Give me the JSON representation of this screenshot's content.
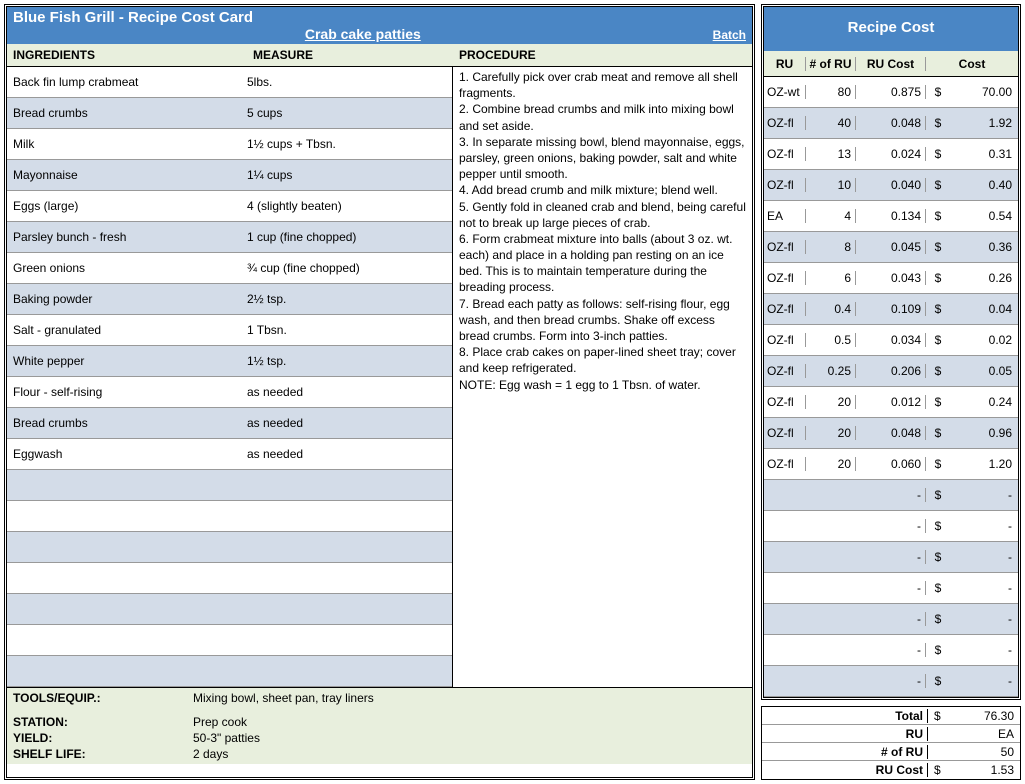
{
  "title": "Blue Fish Grill - Recipe Cost Card",
  "recipe_name": "Crab cake patties",
  "batch_label": "Batch",
  "recipe_cost_title": "Recipe Cost",
  "headers": {
    "ingredients": "INGREDIENTS",
    "measure": "MEASURE",
    "procedure": "PROCEDURE",
    "ru": "RU",
    "num_ru": "# of RU",
    "ru_cost": "RU Cost",
    "cost": "Cost"
  },
  "procedure_text": "1. Carefully pick over crab meat and remove all shell fragments.\n2. Combine bread crumbs and milk into mixing bowl and set aside.\n3. In separate missing bowl, blend mayonnaise, eggs, parsley, green onions, baking powder, salt and white pepper until smooth.\n4. Add bread crumb and milk mixture; blend well.\n5. Gently fold in cleaned crab and blend, being careful not to break up large pieces of crab.\n6. Form crabmeat mixture into balls (about 3 oz. wt. each) and place in a holding pan resting on an ice bed. This is to maintain temperature during the breading process.\n7. Bread each patty as follows: self-rising flour, egg wash, and then bread crumbs. Shake off excess bread crumbs. Form into 3-inch patties.\n8. Place crab cakes on paper-lined sheet tray; cover and keep refrigerated.\nNOTE: Egg wash = 1 egg to 1 Tbsn. of water.",
  "ingredients": [
    {
      "name": "Back fin lump crabmeat",
      "measure": "5lbs.",
      "ru": "OZ-wt",
      "num_ru": "80",
      "ru_cost": "0.875",
      "cost": "70.00"
    },
    {
      "name": "Bread crumbs",
      "measure": "5 cups",
      "ru": "OZ-fl",
      "num_ru": "40",
      "ru_cost": "0.048",
      "cost": "1.92"
    },
    {
      "name": "Milk",
      "measure": "1½ cups + Tbsn.",
      "ru": "OZ-fl",
      "num_ru": "13",
      "ru_cost": "0.024",
      "cost": "0.31"
    },
    {
      "name": "Mayonnaise",
      "measure": "1¼ cups",
      "ru": "OZ-fl",
      "num_ru": "10",
      "ru_cost": "0.040",
      "cost": "0.40"
    },
    {
      "name": "Eggs (large)",
      "measure": "4 (slightly beaten)",
      "ru": "EA",
      "num_ru": "4",
      "ru_cost": "0.134",
      "cost": "0.54"
    },
    {
      "name": "Parsley bunch - fresh",
      "measure": "1 cup (fine chopped)",
      "ru": "OZ-fl",
      "num_ru": "8",
      "ru_cost": "0.045",
      "cost": "0.36"
    },
    {
      "name": "Green onions",
      "measure": "¾ cup (fine chopped)",
      "ru": "OZ-fl",
      "num_ru": "6",
      "ru_cost": "0.043",
      "cost": "0.26"
    },
    {
      "name": "Baking powder",
      "measure": "2½ tsp.",
      "ru": "OZ-fl",
      "num_ru": "0.4",
      "ru_cost": "0.109",
      "cost": "0.04"
    },
    {
      "name": "Salt - granulated",
      "measure": "1 Tbsn.",
      "ru": "OZ-fl",
      "num_ru": "0.5",
      "ru_cost": "0.034",
      "cost": "0.02"
    },
    {
      "name": "White pepper",
      "measure": "1½ tsp.",
      "ru": "OZ-fl",
      "num_ru": "0.25",
      "ru_cost": "0.206",
      "cost": "0.05"
    },
    {
      "name": "Flour - self-rising",
      "measure": "as needed",
      "ru": "OZ-fl",
      "num_ru": "20",
      "ru_cost": "0.012",
      "cost": "0.24"
    },
    {
      "name": "Bread crumbs",
      "measure": "as needed",
      "ru": "OZ-fl",
      "num_ru": "20",
      "ru_cost": "0.048",
      "cost": "0.96"
    },
    {
      "name": "Eggwash",
      "measure": "as needed",
      "ru": "OZ-fl",
      "num_ru": "20",
      "ru_cost": "0.060",
      "cost": "1.20"
    },
    {
      "name": "",
      "measure": "",
      "ru": "",
      "num_ru": "",
      "ru_cost": "-",
      "cost": "-"
    },
    {
      "name": "",
      "measure": "",
      "ru": "",
      "num_ru": "",
      "ru_cost": "-",
      "cost": "-"
    },
    {
      "name": "",
      "measure": "",
      "ru": "",
      "num_ru": "",
      "ru_cost": "-",
      "cost": "-"
    },
    {
      "name": "",
      "measure": "",
      "ru": "",
      "num_ru": "",
      "ru_cost": "-",
      "cost": "-"
    },
    {
      "name": "",
      "measure": "",
      "ru": "",
      "num_ru": "",
      "ru_cost": "-",
      "cost": "-"
    },
    {
      "name": "",
      "measure": "",
      "ru": "",
      "num_ru": "",
      "ru_cost": "-",
      "cost": "-"
    },
    {
      "name": "",
      "measure": "",
      "ru": "",
      "num_ru": "",
      "ru_cost": "-",
      "cost": "-"
    }
  ],
  "footer": {
    "tools_lbl": "TOOLS/EQUIP.:",
    "tools_val": "Mixing bowl, sheet pan, tray liners",
    "station_lbl": "STATION:",
    "station_val": "Prep cook",
    "yield_lbl": "YIELD:",
    "yield_val": "50-3\" patties",
    "shelf_lbl": "SHELF LIFE:",
    "shelf_val": "2 days"
  },
  "summary": {
    "total_lbl": "Total",
    "total_val": "76.30",
    "ru_lbl": "RU",
    "ru_val": "EA",
    "numru_lbl": "# of RU",
    "numru_val": "50",
    "rucost_lbl": "RU Cost",
    "rucost_val": "1.53"
  },
  "dollar": "$"
}
